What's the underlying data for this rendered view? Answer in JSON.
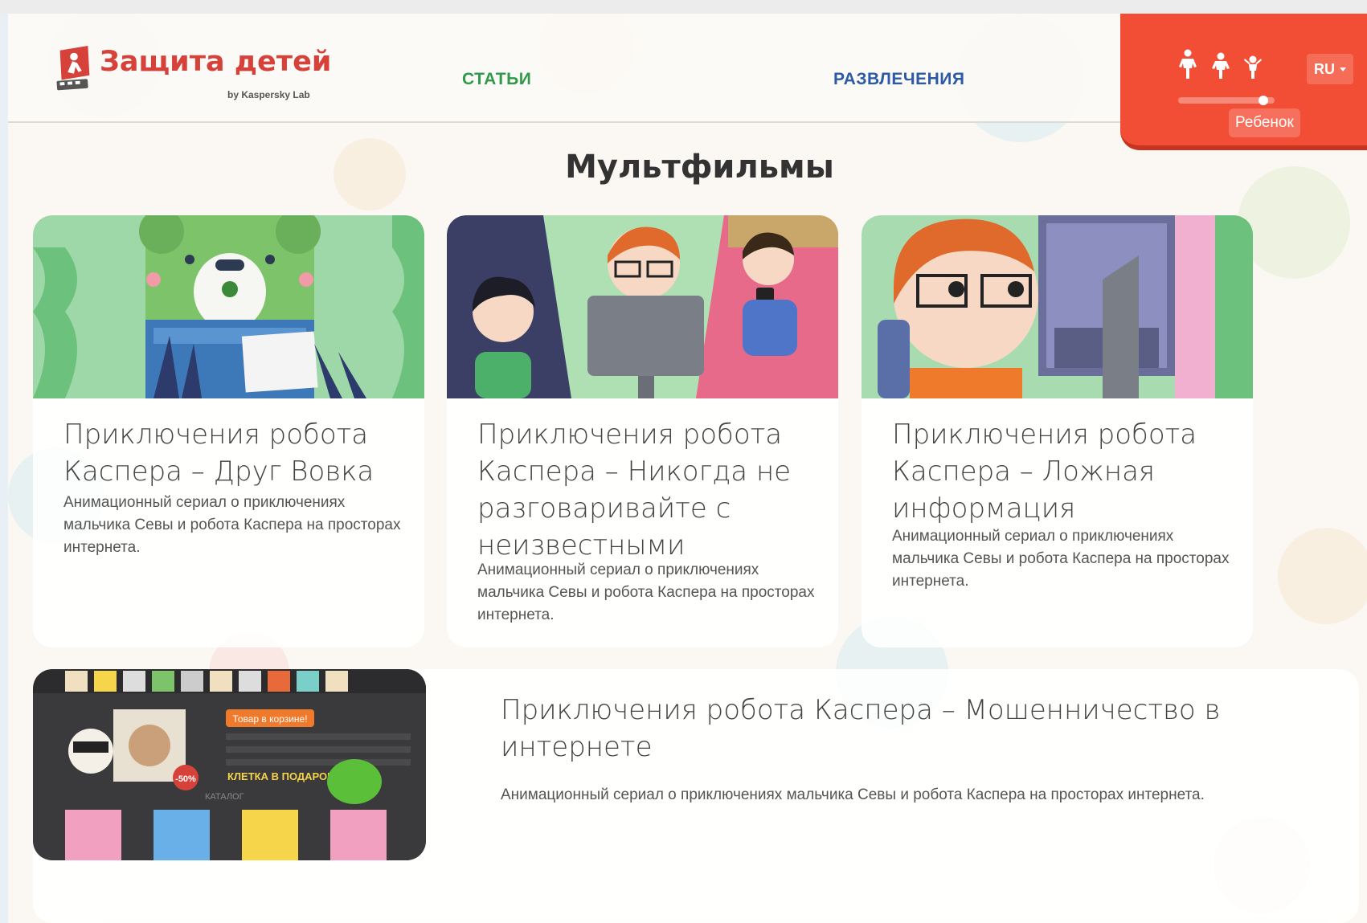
{
  "header": {
    "logo_title": "Защита детей",
    "logo_subtitle": "by Kaspersky Lab",
    "nav": [
      {
        "label": "СТАТЬИ"
      },
      {
        "label": "РАЗВЛЕЧЕНИЯ"
      }
    ],
    "age_selector": {
      "selected_label": "Ребенок",
      "level": 1.0,
      "icons": [
        "teen-icon",
        "child-icon",
        "toddler-icon"
      ]
    },
    "language": "RU"
  },
  "main": {
    "section_title": "Мультфильмы",
    "cards": [
      {
        "title": "Приключения робота Каспера – Друг Вовка",
        "description": "Анимационный сериал о приключениях мальчика Севы и робота Каспера на просторах интернета."
      },
      {
        "title": "Приключения робота Каспера – Никогда не разговаривайте с неизвестными",
        "description": "Анимационный сериал о приключениях мальчика Севы и робота Каспера на просторах интернета."
      },
      {
        "title": "Приключения робота Каспера – Ложная информация",
        "description": "Анимационный сериал о приключениях мальчика Севы и робота Каспера на просторах интернета."
      },
      {
        "title": "Приключения робота Каспера – Мошенничество в интернете",
        "description": "Анимационный сериал о приключениях мальчика Севы и робота Каспера на просторах интернета.",
        "image_texts": {
          "banner": "Товар в корзине!",
          "promo": "КЛЕТКА В ПОДАРОК!",
          "catalog": "КАТАЛОГ",
          "discount": "-50%"
        }
      }
    ]
  },
  "colors": {
    "brand_red": "#d6413a",
    "age_panel": "#f24e36",
    "nav_green": "#2f9a4a",
    "nav_blue": "#2d5aa6"
  }
}
